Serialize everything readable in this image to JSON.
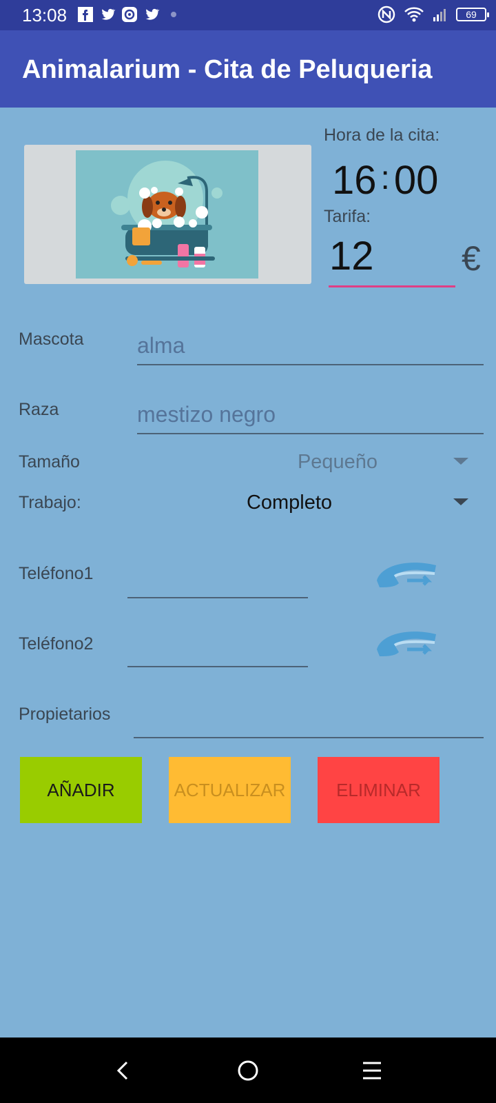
{
  "status_bar": {
    "time": "13:08",
    "battery": "69",
    "left_icons": [
      "facebook-icon",
      "twitter-icon",
      "app-icon",
      "twitter-icon"
    ],
    "right_icons": [
      "nfc-icon",
      "wifi-icon",
      "signal-icon",
      "battery-icon"
    ]
  },
  "app_bar": {
    "title": "Animalarium - Cita de Peluqueria"
  },
  "appointment": {
    "time_label": "Hora de la cita:",
    "hour": "16",
    "minute": "00",
    "separator": ":",
    "price_label": "Tarifa:",
    "price": "12",
    "currency": "€"
  },
  "form": {
    "pet_label": "Mascota",
    "pet_value": "alma",
    "breed_label": "Raza",
    "breed_value": "mestizo negro",
    "size_label": "Tamaño",
    "size_value": "Pequeño",
    "job_label": "Trabajo:",
    "job_value": "Completo",
    "phone1_label": "Teléfono1",
    "phone1_value": "",
    "phone2_label": "Teléfono2",
    "phone2_value": "",
    "owners_label": "Propietarios",
    "owners_value": ""
  },
  "buttons": {
    "add": "AÑADIR",
    "update": "ACTUALIZAR",
    "delete": "ELIMINAR"
  },
  "colors": {
    "status_bar": "#2f3d9a",
    "app_bar": "#3f51b5",
    "background": "#7fb1d6",
    "accent_underline": "#e03e85",
    "add_button": "#99cc00",
    "update_button": "#ffbb33",
    "delete_button": "#ff4444"
  }
}
